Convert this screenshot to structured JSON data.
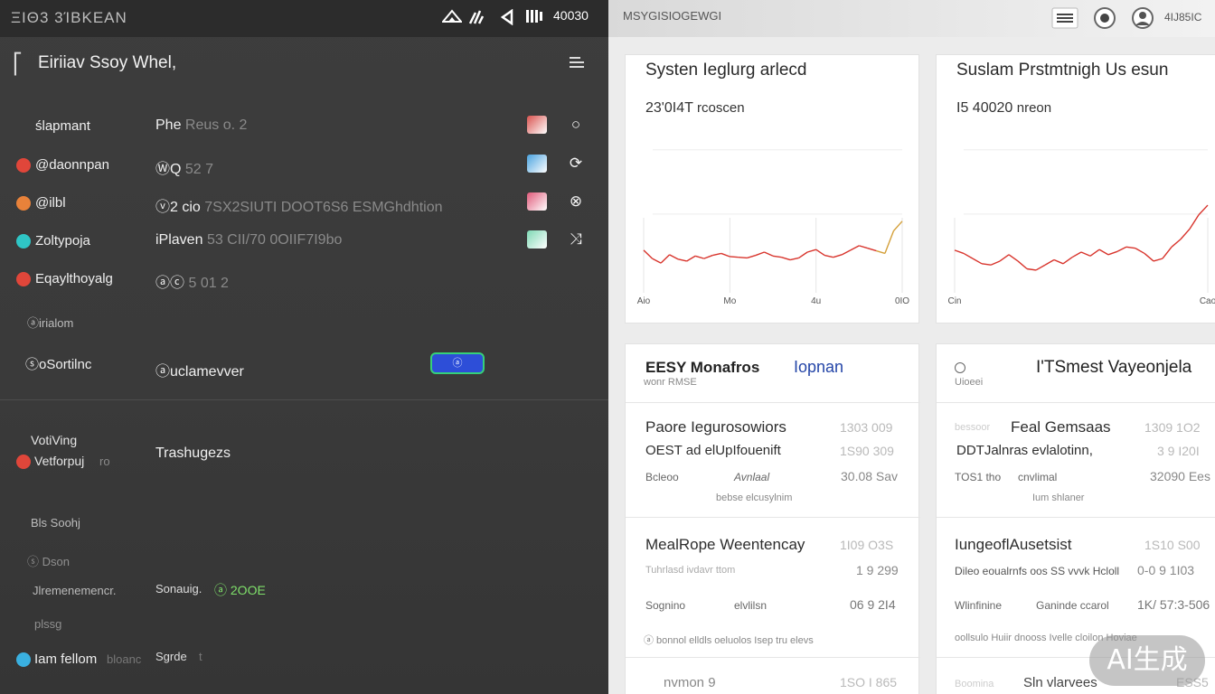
{
  "status_bar": {
    "brand": "ΞΙΘ3 3ΊBKEAN",
    "time": "40030",
    "icons": [
      "wifi-icon",
      "signal-icon",
      "navigation-icon",
      "battery-icon"
    ]
  },
  "left_panel": {
    "title": "Eiriiav Ssoy Whel,",
    "rows": [
      {
        "label": "ślapmant",
        "value": "Phe",
        "value_dim": "Reus o. 2",
        "dot_color": "",
        "tile_color": "#d9534f",
        "action_glyph": "○"
      },
      {
        "label": "@daonnpan",
        "value": "ⓌQ",
        "value_dim": "52 7",
        "dot_color": "#e0463a",
        "tile_color": "#4aa3df",
        "action_glyph": "⟳"
      },
      {
        "label": "@ilbl",
        "value": "ⓥ2 cio",
        "value_dim": "7SX2SIUTI DOOT6S6 ESMGhdhtion",
        "dot_color": "#e8823a",
        "tile_color": "#e05a7a",
        "action_glyph": "⊗"
      },
      {
        "label": "Zoltypoja",
        "value": "iPlaven",
        "value_dim": "53 CII/70 0OIIF7I9bo",
        "dot_color": "#2fc6c6",
        "tile_color": "#7fd9b5",
        "action_glyph": "⤨"
      },
      {
        "label": "Eqaylthoyalg",
        "value": "ⓐⓒ",
        "value_dim": "5 01 2",
        "dot_color": "#e0463a",
        "tile_color": "",
        "action_glyph": ""
      }
    ],
    "sub_label_1": "ⓐirialom",
    "setting_label": "ⓢoSortilnc",
    "setting_value": "ⓐuclamevver",
    "toggle_text": "ⓐ",
    "section2_heading": "VotiVing",
    "section2_label": "Vetforpuj",
    "section2_label_dim": "ro",
    "section2_value": "Trashugezs",
    "item_a": "Bls Soohj",
    "item_b": "ⓢ Dson",
    "item_c": "Jlremenemencr.",
    "item_c_value": "Sonauig.",
    "item_c_badge": "ⓐ 2OOE",
    "item_d": "plssg",
    "item_e": "Iam fellom",
    "item_e_dim": "bloanc",
    "item_e_value": "Sgrde",
    "item_e_value_dim": "t"
  },
  "right_panel": {
    "header_text": "MSYGISIOGEWGI",
    "header_badge": "4IJ85IC",
    "card1": {
      "title": "Systen Ieglurg arlecd",
      "value": "23'0I4T",
      "value_unit": "rcoscen",
      "x_ticks": [
        "Aio",
        "Mo",
        "4u",
        "0IO"
      ]
    },
    "card2": {
      "title": "Suslam Prstmtnigh Us esun",
      "value": "I5 40020",
      "value_unit": "nreon",
      "x_ticks": [
        "Cin",
        "Cao"
      ]
    },
    "table1": {
      "title": "EESY Monafros",
      "title_accent": "Iopnan",
      "subtitle": "wonr RMSE",
      "rows": [
        {
          "name": "Paore Iegurosowiors",
          "num": "1303 009"
        },
        {
          "name": "OEST ad elUpIfouenift",
          "num": "1S90 309"
        },
        {
          "name": "Bcleoo",
          "name2": "Avnlaal",
          "num": "30.08 Sav",
          "note": "bebse elcusylnim"
        }
      ],
      "section": "MealRope Weentencay",
      "section_num": "1I09 O3S",
      "section_rows": [
        {
          "name": "Tuhrlasd ivdavr ttom",
          "num": "1 9 299"
        },
        {
          "name": "Sognino",
          "name2": "elvlilsn",
          "num": "06 9 2I4"
        }
      ],
      "foot": "ⓐ bonnol  elldls  oeluolos Isep tru elevs",
      "last": "nvmon 9",
      "last_num": "1SO I 865"
    },
    "table2": {
      "title": "I'TSmest Vayeonjela",
      "subtitle": "Uioeei",
      "rows": [
        {
          "name": "Feal Gemsaas",
          "dim": "bessoor",
          "num": "1309 1O2"
        },
        {
          "name": "DDTJalnras evlalotinn,",
          "num": "3 9 I20I"
        },
        {
          "name": "TOS1 tho",
          "name2": "cnvlimal",
          "num": "32090 Ees",
          "note": "Ium shlaner"
        }
      ],
      "section": "IungeoflAusetsist",
      "section_num": "1S10 S00",
      "section_rows": [
        {
          "name": "Dileo eoualrnfs oos SS vvvk Hcloll",
          "num": "0-0 9 1I03"
        },
        {
          "name": "Wlinfinine",
          "name2": "Ganinde ccarol",
          "num": "1K/ 57:3-506"
        }
      ],
      "foot": "oollsulo  Huiir  dnooss  Ivelle  cloilon  Hoviae",
      "last": "Sln vlarvees",
      "last_dim": "Boomina",
      "last_num": "ESS5"
    }
  },
  "watermark": "AI生成",
  "colors": {
    "accent_toggle": "#2d4ed8",
    "toggle_border": "#35d07a",
    "chart_line": "#d8342c",
    "chart_line_end": "#d4a03a"
  },
  "chart_data": [
    {
      "type": "line",
      "title": "Systen Ieglurg arlecd",
      "x": [
        "Aio",
        "Mo",
        "4u",
        "0IO"
      ],
      "series": [
        {
          "values": [
            0.55,
            0.42,
            0.35,
            0.48,
            0.41,
            0.38,
            0.46,
            0.42,
            0.47,
            0.5,
            0.45,
            0.44,
            0.43,
            0.47,
            0.52,
            0.46,
            0.44,
            0.4,
            0.43,
            0.52,
            0.56,
            0.47,
            0.44,
            0.48,
            0.55,
            0.62,
            0.58,
            0.54,
            0.5,
            0.85,
            1.0
          ]
        }
      ],
      "ylim": [
        0,
        2.6
      ]
    },
    {
      "type": "line",
      "title": "Suslam Prstmtnigh Us esun",
      "x": [
        "Cin",
        "Cao"
      ],
      "series": [
        {
          "values": [
            0.55,
            0.5,
            0.42,
            0.34,
            0.32,
            0.38,
            0.48,
            0.38,
            0.26,
            0.24,
            0.32,
            0.4,
            0.34,
            0.44,
            0.52,
            0.46,
            0.56,
            0.48,
            0.53,
            0.6,
            0.58,
            0.5,
            0.38,
            0.42,
            0.6,
            0.72,
            0.88,
            1.1,
            1.25
          ]
        }
      ],
      "ylim": [
        0,
        2.6
      ]
    }
  ]
}
